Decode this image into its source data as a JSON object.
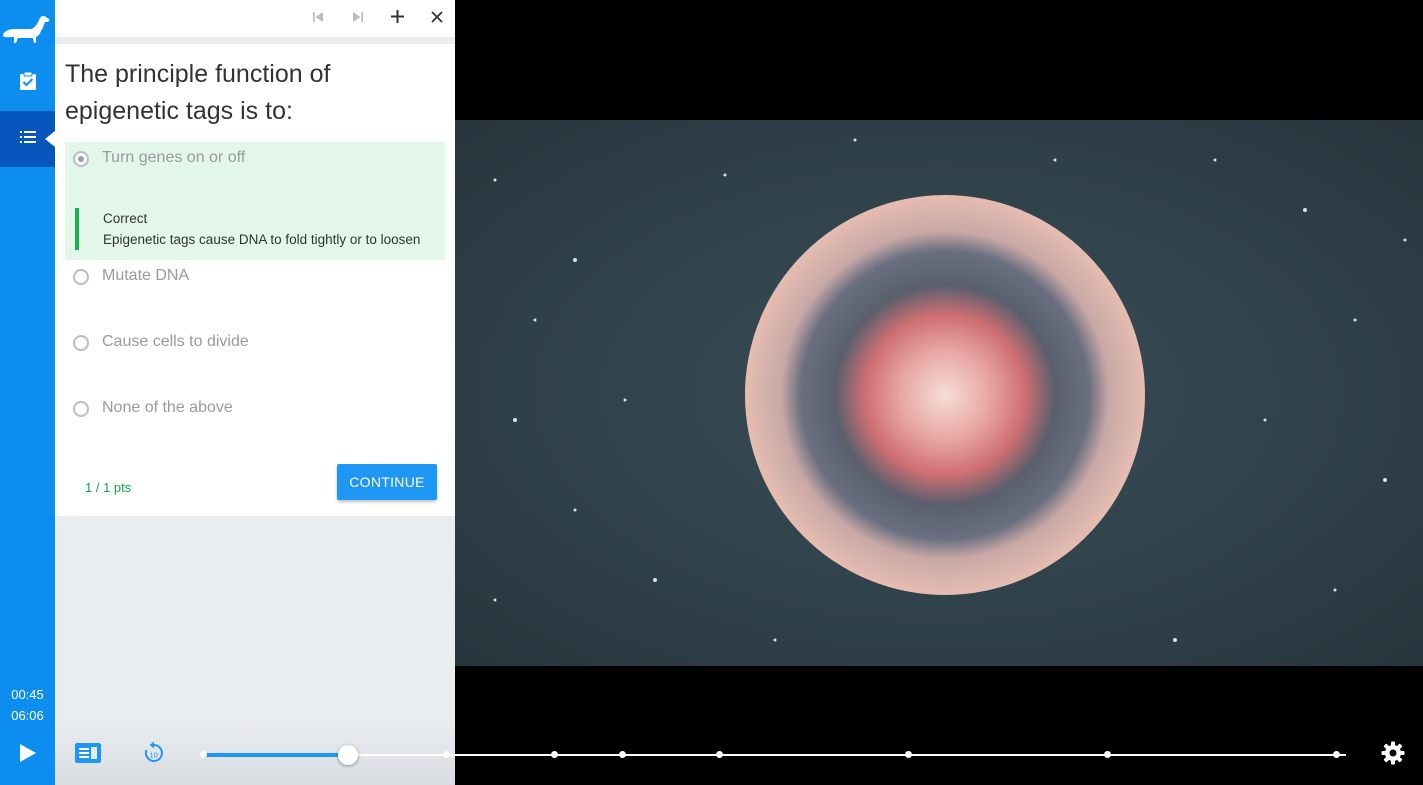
{
  "rail": {
    "time_current": "00:45",
    "time_total": "06:06",
    "items": [
      {
        "icon": "clipboard-check-icon"
      },
      {
        "icon": "list-icon",
        "active": true
      }
    ]
  },
  "toolbar": {
    "icons": [
      "skip-previous-icon",
      "skip-next-icon",
      "add-icon",
      "close-icon"
    ]
  },
  "quiz": {
    "question": "The principle function of epigenetic tags is to:",
    "options": [
      {
        "label": "Turn genes on or off",
        "selected": true
      },
      {
        "label": "Mutate DNA"
      },
      {
        "label": "Cause cells to divide"
      },
      {
        "label": "None of the above"
      }
    ],
    "feedback": {
      "status": "Correct",
      "text": "Epigenetic tags cause DNA to fold tightly or to loosen"
    },
    "points": "1 / 1 pts",
    "continue_label": "CONTINUE"
  },
  "player": {
    "progress": 0.128,
    "markers": [
      0.002,
      0.214,
      0.309,
      0.368,
      0.453,
      0.618,
      0.792,
      0.992
    ],
    "accent": "#1e96f3",
    "icons": [
      "play-icon",
      "transcript-icon",
      "replay-10-icon",
      "settings-icon"
    ]
  },
  "colors": {
    "rail": "#0c8ef0",
    "rail_active": "#0756bd",
    "correct": "#16b24b"
  }
}
